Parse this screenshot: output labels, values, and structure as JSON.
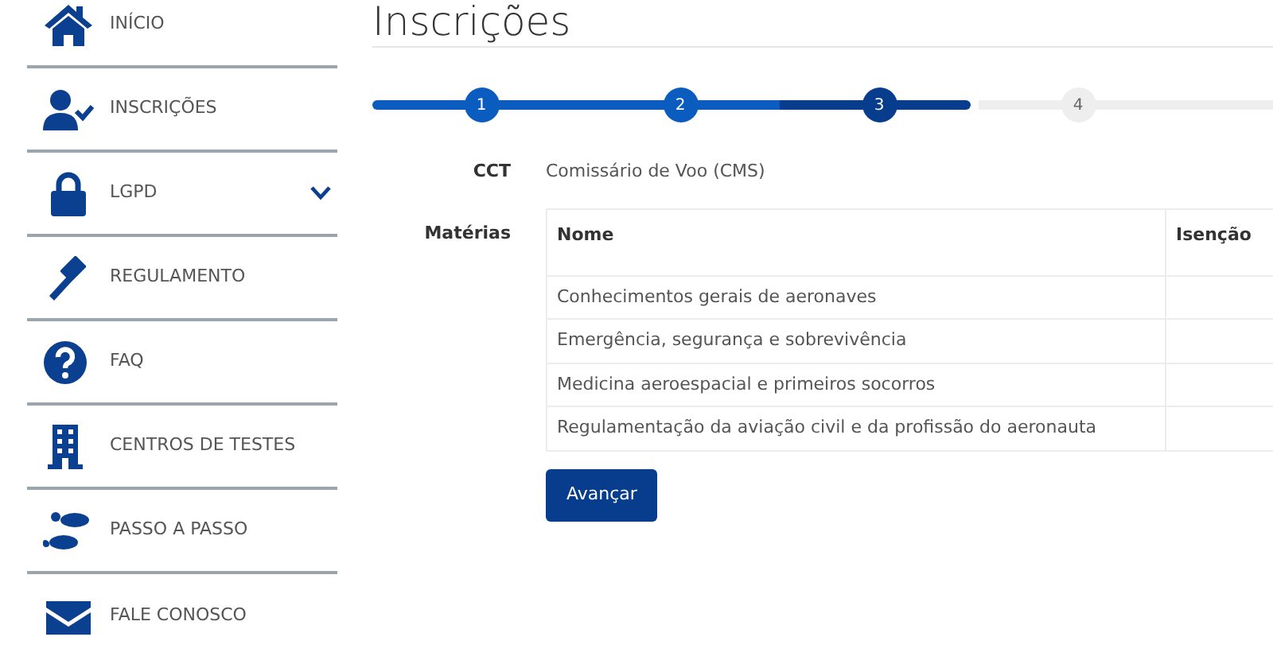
{
  "sidebar": {
    "items": [
      {
        "label": "INÍCIO"
      },
      {
        "label": "INSCRIÇÕES"
      },
      {
        "label": "LGPD",
        "expanded": false
      },
      {
        "label": "REGULAMENTO"
      },
      {
        "label": "FAQ"
      },
      {
        "label": "CENTROS DE TESTES"
      },
      {
        "label": "PASSO A PASSO"
      },
      {
        "label": "FALE CONOSCO"
      }
    ]
  },
  "page_title": "Inscrições",
  "stepper": [
    {
      "label": "1",
      "selected": false
    },
    {
      "label": "2",
      "selected": false
    },
    {
      "label": "3",
      "selected": true
    },
    {
      "label": "4",
      "selected": false
    }
  ],
  "form": {
    "cct": {
      "label": "CCT",
      "value": "Comissário de Voo (CMS)"
    },
    "materias": {
      "label": "Matérias",
      "columns": [
        "Nome",
        "Isenção"
      ],
      "rows": [
        {
          "nome": "Conhecimentos gerais de aeronaves"
        },
        {
          "nome": "Emergência, segurança e sobrevivência"
        },
        {
          "nome": "Medicina aeroespacial e primeiros socorros"
        },
        {
          "nome": "Regulamentação da aviação civil e da profissão do aeronauta"
        }
      ]
    }
  },
  "button": "Avançar"
}
